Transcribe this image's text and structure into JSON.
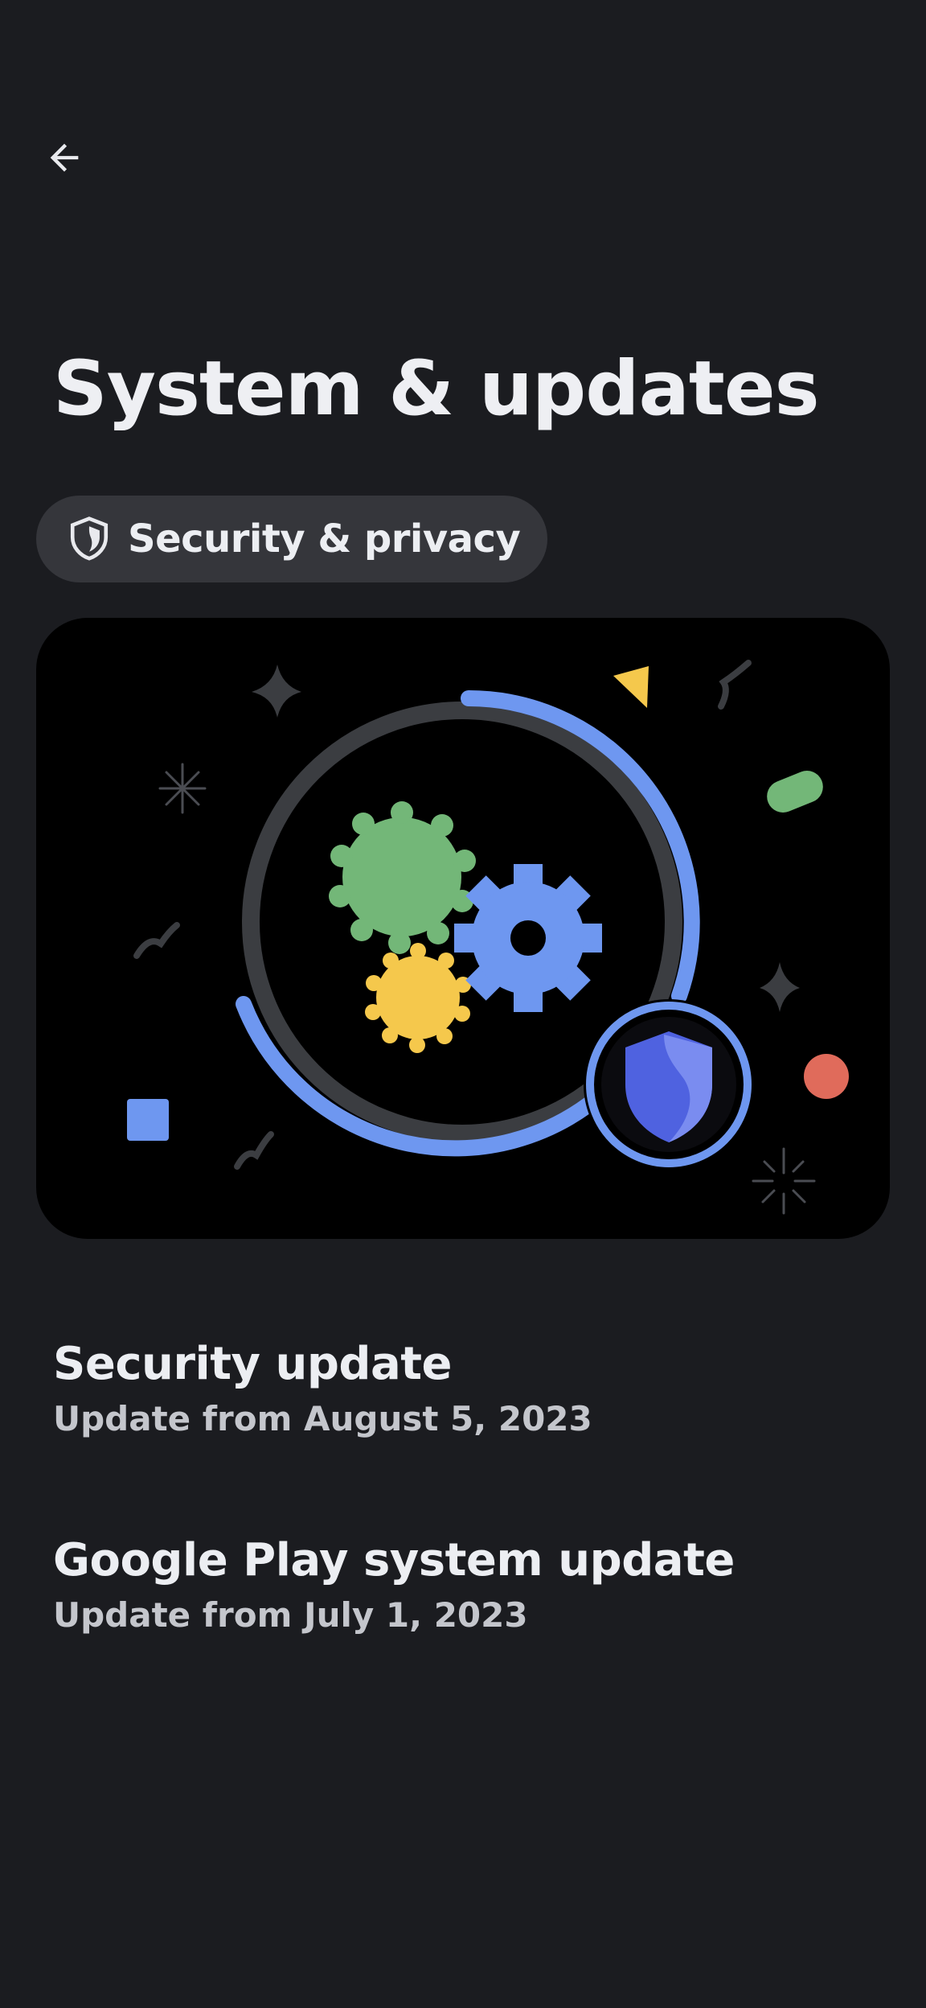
{
  "header": {
    "back_icon": "arrow-back-icon",
    "title": "System & updates"
  },
  "chip": {
    "icon": "shield-icon",
    "label": "Security & privacy"
  },
  "hero": {
    "illustration": "gears-with-shield"
  },
  "items": [
    {
      "title": "Security update",
      "subtitle": "Update from August 5, 2023"
    },
    {
      "title": "Google Play system update",
      "subtitle": "Update from July 1, 2023"
    }
  ],
  "colors": {
    "background": "#1b1c20",
    "chip_background": "#35363b",
    "text_primary": "#eceef2",
    "text_secondary": "#c4c6cc",
    "accent_blue": "#6e97f0",
    "green": "#73b778",
    "yellow": "#f5c84c",
    "red": "#e06b5b"
  }
}
